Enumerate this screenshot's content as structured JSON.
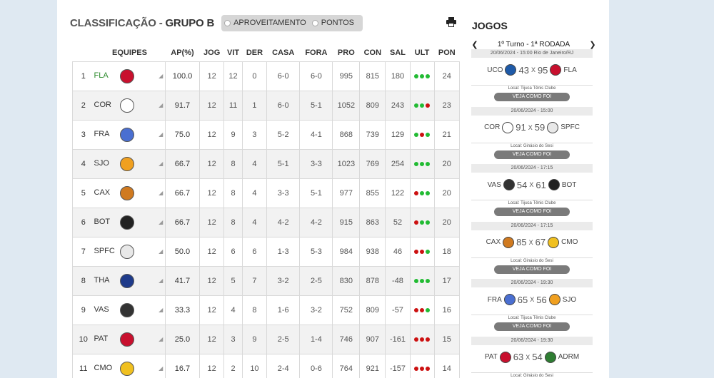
{
  "standings": {
    "title_prefix": "CLASSIFICAÇÃO - ",
    "title_group": "GRUPO B",
    "toggle": {
      "option1": "APROVEITAMENTO",
      "option2": "PONTOS"
    },
    "headers": [
      "EQUIPES",
      "AP(%)",
      "JOG",
      "VIT",
      "DER",
      "CASA",
      "FORA",
      "PRO",
      "CON",
      "SAL",
      "ULT",
      "PON"
    ],
    "rows": [
      {
        "pos": "1",
        "team": "FLA",
        "ap": "100.0",
        "jog": "12",
        "vit": "12",
        "der": "0",
        "casa": "6-0",
        "fora": "6-0",
        "pro": "995",
        "con": "815",
        "sal": "180",
        "ult": [
          "green",
          "green",
          "green"
        ],
        "pon": "24",
        "logo": "#c8102e"
      },
      {
        "pos": "2",
        "team": "COR",
        "ap": "91.7",
        "jog": "12",
        "vit": "11",
        "der": "1",
        "casa": "6-0",
        "fora": "5-1",
        "pro": "1052",
        "con": "809",
        "sal": "243",
        "ult": [
          "green",
          "green",
          "red"
        ],
        "pon": "23",
        "logo": "#ffffff"
      },
      {
        "pos": "3",
        "team": "FRA",
        "ap": "75.0",
        "jog": "12",
        "vit": "9",
        "der": "3",
        "casa": "5-2",
        "fora": "4-1",
        "pro": "868",
        "con": "739",
        "sal": "129",
        "ult": [
          "green",
          "red",
          "green"
        ],
        "pon": "21",
        "logo": "#4a6fd1"
      },
      {
        "pos": "4",
        "team": "SJO",
        "ap": "66.7",
        "jog": "12",
        "vit": "8",
        "der": "4",
        "casa": "5-1",
        "fora": "3-3",
        "pro": "1023",
        "con": "769",
        "sal": "254",
        "ult": [
          "green",
          "green",
          "green"
        ],
        "pon": "20",
        "logo": "#f0a020"
      },
      {
        "pos": "5",
        "team": "CAX",
        "ap": "66.7",
        "jog": "12",
        "vit": "8",
        "der": "4",
        "casa": "3-3",
        "fora": "5-1",
        "pro": "977",
        "con": "855",
        "sal": "122",
        "ult": [
          "red",
          "green",
          "green"
        ],
        "pon": "20",
        "logo": "#d07a20"
      },
      {
        "pos": "6",
        "team": "BOT",
        "ap": "66.7",
        "jog": "12",
        "vit": "8",
        "der": "4",
        "casa": "4-2",
        "fora": "4-2",
        "pro": "915",
        "con": "863",
        "sal": "52",
        "ult": [
          "red",
          "green",
          "green"
        ],
        "pon": "20",
        "logo": "#222222"
      },
      {
        "pos": "7",
        "team": "SPFC",
        "ap": "50.0",
        "jog": "12",
        "vit": "6",
        "der": "6",
        "casa": "1-3",
        "fora": "5-3",
        "pro": "984",
        "con": "938",
        "sal": "46",
        "ult": [
          "red",
          "red",
          "green"
        ],
        "pon": "18",
        "logo": "#e8e8e8"
      },
      {
        "pos": "8",
        "team": "THA",
        "ap": "41.7",
        "jog": "12",
        "vit": "5",
        "der": "7",
        "casa": "3-2",
        "fora": "2-5",
        "pro": "830",
        "con": "878",
        "sal": "-48",
        "ult": [
          "green",
          "green",
          "green"
        ],
        "pon": "17",
        "logo": "#1e3a8a"
      },
      {
        "pos": "9",
        "team": "VAS",
        "ap": "33.3",
        "jog": "12",
        "vit": "4",
        "der": "8",
        "casa": "1-6",
        "fora": "3-2",
        "pro": "752",
        "con": "809",
        "sal": "-57",
        "ult": [
          "red",
          "red",
          "green"
        ],
        "pon": "16",
        "logo": "#333333"
      },
      {
        "pos": "10",
        "team": "PAT",
        "ap": "25.0",
        "jog": "12",
        "vit": "3",
        "der": "9",
        "casa": "2-5",
        "fora": "1-4",
        "pro": "746",
        "con": "907",
        "sal": "-161",
        "ult": [
          "red",
          "red",
          "red"
        ],
        "pon": "15",
        "logo": "#c8102e"
      },
      {
        "pos": "11",
        "team": "CMO",
        "ap": "16.7",
        "jog": "12",
        "vit": "2",
        "der": "10",
        "casa": "2-4",
        "fora": "0-6",
        "pro": "764",
        "con": "921",
        "sal": "-157",
        "ult": [
          "red",
          "red",
          "red"
        ],
        "pon": "14",
        "logo": "#f0c020"
      }
    ]
  },
  "games": {
    "title": "JOGOS",
    "round_label": "1º Turno - 1ª RODADA",
    "list": [
      {
        "header": "20/06/2024 - 15:00",
        "city": "Rio de Janeiro/RJ",
        "home": "UCO",
        "home_score": "43",
        "away_score": "95",
        "away": "FLA",
        "local": "Local: Tijuca Tênis Clube",
        "button": "VEJA COMO FOI",
        "home_logo": "#1e5aa8",
        "away_logo": "#c8102e"
      },
      {
        "header": "20/06/2024 - 15:00",
        "city": "",
        "home": "COR",
        "home_score": "91",
        "away_score": "59",
        "away": "SPFC",
        "local": "Local: Ginásio do Sesi",
        "button": "VEJA COMO FOI",
        "home_logo": "#ffffff",
        "away_logo": "#e8e8e8"
      },
      {
        "header": "20/06/2024 - 17:15",
        "city": "",
        "home": "VAS",
        "home_score": "54",
        "away_score": "61",
        "away": "BOT",
        "local": "Local: Tijuca Tênis Clube",
        "button": "VEJA COMO FOI",
        "home_logo": "#333333",
        "away_logo": "#222222"
      },
      {
        "header": "20/06/2024 - 17:15",
        "city": "",
        "home": "CAX",
        "home_score": "85",
        "away_score": "67",
        "away": "CMO",
        "local": "Local: Ginásio do Sesi",
        "button": "VEJA COMO FOI",
        "home_logo": "#d07a20",
        "away_logo": "#f0c020"
      },
      {
        "header": "20/06/2024 - 19:30",
        "city": "",
        "home": "FRA",
        "home_score": "65",
        "away_score": "56",
        "away": "SJO",
        "local": "Local: Tijuca Tênis Clube",
        "button": "VEJA COMO FOI",
        "home_logo": "#4a6fd1",
        "away_logo": "#f0a020"
      },
      {
        "header": "20/06/2024 - 19:30",
        "city": "",
        "home": "PAT",
        "home_score": "63",
        "away_score": "54",
        "away": "ADRM",
        "local": "Local: Ginásio do Sesi",
        "button": "",
        "home_logo": "#c8102e",
        "away_logo": "#2e7d32"
      }
    ]
  },
  "colors": {
    "green": "#22bb33",
    "red": "#cc1111"
  },
  "icons": {
    "print": "printer-icon",
    "prev": "chevron-left-icon",
    "next": "chevron-right-icon"
  }
}
